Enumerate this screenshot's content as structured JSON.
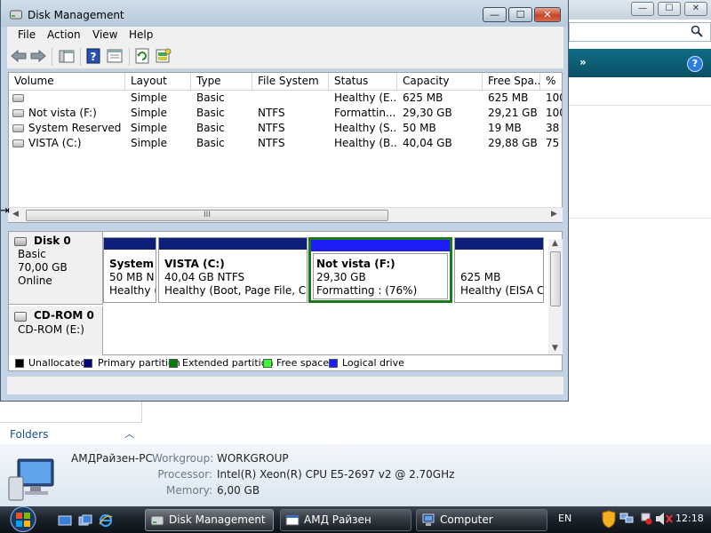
{
  "window": {
    "title": "Disk Management",
    "minimize_glyph": "—",
    "maximize_glyph": "☐",
    "close_glyph": "✕"
  },
  "menu": [
    "File",
    "Action",
    "View",
    "Help"
  ],
  "toolbar_icons": [
    "back-arrow-icon",
    "forward-arrow-icon",
    "console-tree-icon",
    "help-icon",
    "properties-icon",
    "refresh-icon",
    "rescan-disks-icon"
  ],
  "volume_list": {
    "columns": [
      "Volume",
      "Layout",
      "Type",
      "File System",
      "Status",
      "Capacity",
      "Free Spa...",
      "%"
    ],
    "rows": [
      [
        "",
        "Simple",
        "Basic",
        "",
        "Healthy (E...",
        "625 MB",
        "625 MB",
        "100"
      ],
      [
        "Not vista (F:)",
        "Simple",
        "Basic",
        "NTFS",
        "Formattin...",
        "29,30 GB",
        "29,21 GB",
        "100"
      ],
      [
        "System Reserved (...",
        "Simple",
        "Basic",
        "NTFS",
        "Healthy (S...",
        "50 MB",
        "19 MB",
        "38"
      ],
      [
        "VISTA (C:)",
        "Simple",
        "Basic",
        "NTFS",
        "Healthy (B...",
        "40,04 GB",
        "29,88 GB",
        "75"
      ]
    ],
    "hscroll_grip": "III"
  },
  "disks": [
    {
      "name": "Disk 0",
      "type": "Basic",
      "size": "70,00 GB",
      "status": "Online",
      "partitions": [
        {
          "name": "System I",
          "line2": "50 MB N",
          "line3": "Healthy (",
          "bar": "primary"
        },
        {
          "name": "VISTA  (C:)",
          "line2": "40,04 GB NTFS",
          "line3": "Healthy (Boot, Page File, Cras",
          "bar": "primary"
        },
        {
          "name": "Not vista  (F:)",
          "line2": "29,30 GB",
          "line3": "Formatting : (76%)",
          "bar": "logical",
          "selected": true
        },
        {
          "name": "",
          "line2": "625 MB",
          "line3": "Healthy (EISA Co",
          "bar": "primary"
        }
      ]
    },
    {
      "name": "CD-ROM 0",
      "type": "CD-ROM (E:)"
    }
  ],
  "legend": [
    {
      "label": "Unallocated",
      "color": "#000000"
    },
    {
      "label": "Primary partition",
      "color": "#000080"
    },
    {
      "label": "Extended partition",
      "color": "#008000"
    },
    {
      "label": "Free space",
      "color": "#33ff33"
    },
    {
      "label": "Logical drive",
      "color": "#1c1cff"
    }
  ],
  "colors": {
    "primary": "#0e1f7a",
    "logical": "#1d1df5",
    "selection": "#1a7a1a"
  },
  "background_window": {
    "folders_label": "Folders",
    "computer_name": "АМДРайзен-PC",
    "workgroup_key": "Workgroup:",
    "workgroup_value": "WORKGROUP",
    "processor_key": "Processor:",
    "processor_value": "Intel(R) Xeon(R) CPU E5-2697 v2 @ 2.70GHz",
    "memory_key": "Memory:",
    "memory_value": "6,00 GB"
  },
  "taskbar": {
    "buttons": [
      "Disk Management",
      "АМД Райзен",
      "Computer"
    ],
    "language": "EN",
    "clock": "12:18"
  }
}
